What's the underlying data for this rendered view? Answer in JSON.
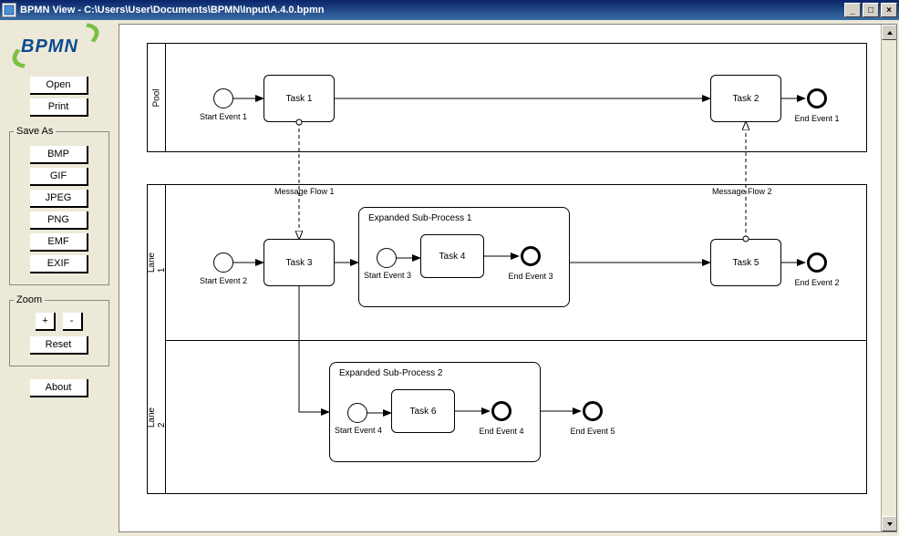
{
  "window": {
    "title": "BPMN View - C:\\Users\\User\\Documents\\BPMN\\Input\\A.4.0.bpmn"
  },
  "logo": {
    "text": "BPMN"
  },
  "buttons": {
    "open": "Open",
    "print": "Print",
    "about": "About",
    "reset": "Reset",
    "zoom_in": "+",
    "zoom_out": "-"
  },
  "groups": {
    "saveas": "Save As",
    "zoom": "Zoom"
  },
  "saveas": {
    "bmp": "BMP",
    "gif": "GIF",
    "jpeg": "JPEG",
    "png": "PNG",
    "emf": "EMF",
    "exif": "EXIF"
  },
  "diagram": {
    "pool1": {
      "label": "Pool"
    },
    "pool2": {
      "lane1": "Lane 1",
      "lane2": "Lane 2"
    },
    "tasks": {
      "t1": "Task 1",
      "t2": "Task 2",
      "t3": "Task 3",
      "t4": "Task 4",
      "t5": "Task 5",
      "t6": "Task 6"
    },
    "events": {
      "se1": "Start Event 1",
      "ee1": "End Event 1",
      "se2": "Start Event 2",
      "se3": "Start Event 3",
      "se4": "Start Event 4",
      "ee2": "End Event 2",
      "ee3": "End Event 3",
      "ee4": "End Event 4",
      "ee5": "End Event 5"
    },
    "subprocesses": {
      "sp1": "Expanded Sub-Process 1",
      "sp2": "Expanded Sub-Process 2"
    },
    "messages": {
      "m1": "Message Flow 1",
      "m2": "Message Flow 2"
    }
  }
}
